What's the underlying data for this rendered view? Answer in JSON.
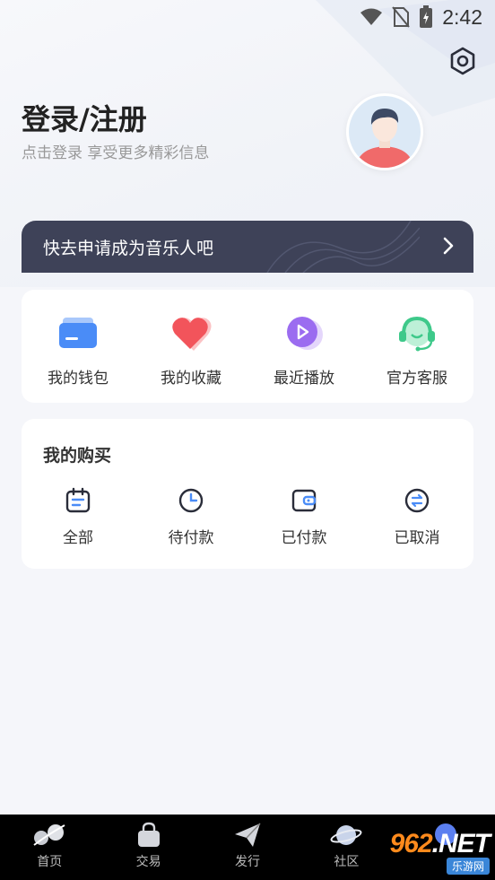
{
  "status_bar": {
    "time": "2:42"
  },
  "header": {
    "title": "登录/注册",
    "subtitle": "点击登录 享受更多精彩信息"
  },
  "banner": {
    "text": "快去申请成为音乐人吧"
  },
  "quick_actions": [
    {
      "label": "我的钱包",
      "icon": "wallet-icon",
      "color": "#4a8cf7"
    },
    {
      "label": "我的收藏",
      "icon": "heart-icon",
      "color": "#f2545b"
    },
    {
      "label": "最近播放",
      "icon": "play-icon",
      "color": "#9b6cf0"
    },
    {
      "label": "官方客服",
      "icon": "headset-icon",
      "color": "#3ec98a"
    }
  ],
  "purchases": {
    "title": "我的购买",
    "items": [
      {
        "label": "全部",
        "icon": "calendar-icon"
      },
      {
        "label": "待付款",
        "icon": "clock-icon"
      },
      {
        "label": "已付款",
        "icon": "wallet-card-icon"
      },
      {
        "label": "已取消",
        "icon": "exchange-icon"
      }
    ]
  },
  "bottom_nav": [
    {
      "label": "首页",
      "icon": "home-icon"
    },
    {
      "label": "交易",
      "icon": "bag-icon"
    },
    {
      "label": "发行",
      "icon": "send-icon"
    },
    {
      "label": "社区",
      "icon": "planet-icon"
    },
    {
      "label": "",
      "icon": "profile-dot-icon"
    }
  ],
  "watermark": {
    "brand_num": "962",
    "brand_suffix": ".NET",
    "sub": "乐游网"
  },
  "colors": {
    "accent_blue": "#4a8cf7",
    "banner_bg": "#3e4258",
    "page_bg": "#f5f6fa"
  }
}
